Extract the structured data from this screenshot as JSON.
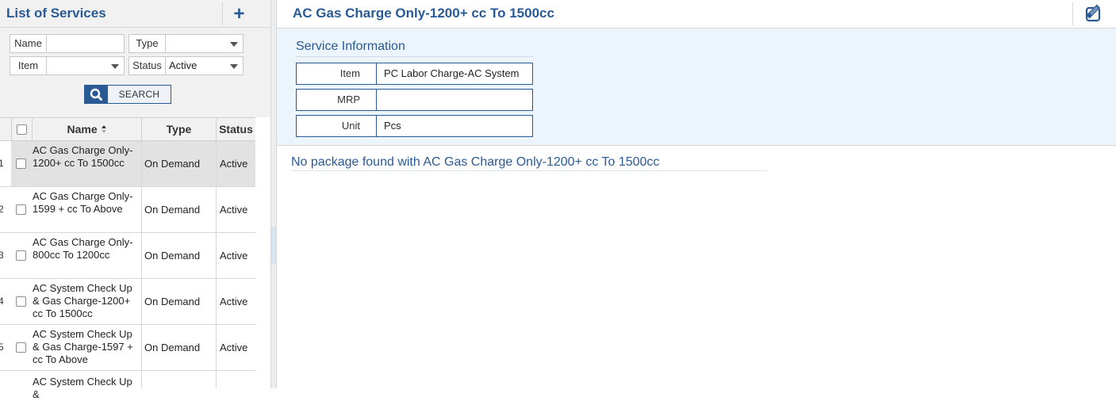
{
  "left_panel": {
    "title": "List of Services",
    "add_icon": "plus-icon",
    "filters": {
      "name_label": "Name",
      "name_value": "",
      "type_label": "Type",
      "type_value": "",
      "item_label": "Item",
      "item_value": "",
      "status_label": "Status",
      "status_value": "Active",
      "search_label": "SEARCH",
      "search_icon": "magnifier-icon"
    },
    "columns": {
      "name": "Name",
      "type": "Type",
      "status": "Status"
    },
    "rows": [
      {
        "num": "1",
        "name": "AC Gas Charge Only-1200+ cc To 1500cc",
        "type": "On Demand",
        "status": "Active",
        "selected": true
      },
      {
        "num": "2",
        "name": "AC Gas Charge Only-1599 + cc To Above",
        "type": "On Demand",
        "status": "Active",
        "selected": false
      },
      {
        "num": "3",
        "name": "AC Gas Charge Only-800cc To 1200cc",
        "type": "On Demand",
        "status": "Active",
        "selected": false
      },
      {
        "num": "4",
        "name": "AC System Check Up & Gas Charge-1200+ cc To 1500cc",
        "type": "On Demand",
        "status": "Active",
        "selected": false
      },
      {
        "num": "5",
        "name": "AC System Check Up & Gas Charge-1597 + cc To Above",
        "type": "On Demand",
        "status": "Active",
        "selected": false
      },
      {
        "num": "",
        "name": "AC System Check Up &",
        "type": "",
        "status": "",
        "selected": false
      }
    ]
  },
  "detail": {
    "title": "AC Gas Charge Only-1200+ cc To 1500cc",
    "edit_icon": "edit-icon",
    "section_title": "Service Information",
    "fields": [
      {
        "label": "Item",
        "value": "PC Labor Charge-AC System"
      },
      {
        "label": "MRP",
        "value": ""
      },
      {
        "label": "Unit",
        "value": "Pcs"
      }
    ],
    "no_package_text": "No package found with AC Gas Charge Only-1200+ cc To 1500cc"
  },
  "colors": {
    "accent": "#2a5a95",
    "panel_bg": "#f1f1f1",
    "info_bg": "#ebf5fb",
    "selected_row": "#e2e2e2"
  }
}
